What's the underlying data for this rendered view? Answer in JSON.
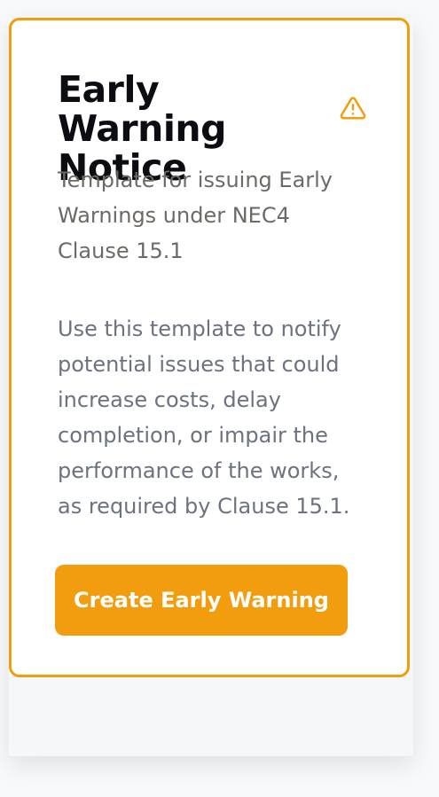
{
  "card": {
    "title": "Early Warning Notice",
    "icon": "warning-triangle-icon",
    "subtitle": "Template for issuing Early Warnings under NEC4 Clause 15.1",
    "description": "Use this template to notify potential issues that could increase costs, delay completion, or impair the performance of the works, as required by Clause 15.1.",
    "button_label": "Create Early Warning"
  },
  "colors": {
    "accent": "#f29d0e",
    "title": "#0b0d12",
    "subtitle": "#6d6a66",
    "description": "#6b7280",
    "background": "#f8f9fb"
  }
}
